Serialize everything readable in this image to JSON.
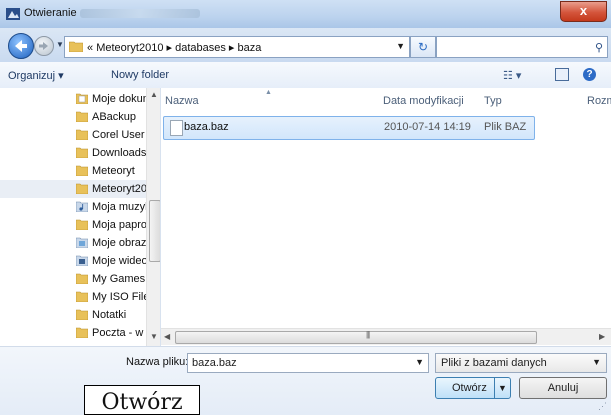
{
  "window": {
    "title": "Otwieranie",
    "close_label": "x"
  },
  "address_bar": {
    "breadcrumb_prefix": "«",
    "breadcrumbs": [
      "Meteoryt2010",
      "databases",
      "baza"
    ],
    "search_placeholder": ""
  },
  "toolbar": {
    "organize_label": "Organizuj ▾",
    "new_folder_label": "Nowy folder"
  },
  "nav_pane": {
    "items": [
      {
        "label": "Moje dokumenty",
        "icon": "documents-icon"
      },
      {
        "label": "ABackup",
        "icon": "folder-icon"
      },
      {
        "label": "Corel User Files",
        "icon": "folder-icon"
      },
      {
        "label": "Downloads",
        "icon": "folder-icon"
      },
      {
        "label": "Meteoryt",
        "icon": "folder-icon"
      },
      {
        "label": "Meteoryt2010",
        "icon": "folder-icon"
      },
      {
        "label": "Moja muzyka",
        "icon": "music-folder-icon"
      },
      {
        "label": "Moja paproszki",
        "icon": "folder-icon"
      },
      {
        "label": "Moje obrazy",
        "icon": "pictures-folder-icon"
      },
      {
        "label": "Moje wideo",
        "icon": "video-folder-icon"
      },
      {
        "label": "My Games",
        "icon": "folder-icon"
      },
      {
        "label": "My ISO Files",
        "icon": "folder-icon"
      },
      {
        "label": "Notatki",
        "icon": "folder-icon"
      },
      {
        "label": "Poczta - w",
        "icon": "folder-icon"
      }
    ],
    "selected_index": 5
  },
  "file_list": {
    "columns": [
      "Nazwa",
      "Data modyfikacji",
      "Typ",
      "Rozmiar"
    ],
    "rows": [
      {
        "name": "baza.baz",
        "date": "2010-07-14 14:19",
        "type": "Plik BAZ"
      }
    ]
  },
  "bottom": {
    "filename_label": "Nazwa pliku:",
    "filename_value": "baza.baz",
    "filetype_value": "Pliki z bazami danych",
    "open_label": "Otwórz",
    "cancel_label": "Anuluj"
  },
  "tooltip": {
    "text": "Otwórz"
  },
  "colors": {
    "accent": "#2d6bc6",
    "selection": "#d2e6fb",
    "close": "#c4391c"
  }
}
